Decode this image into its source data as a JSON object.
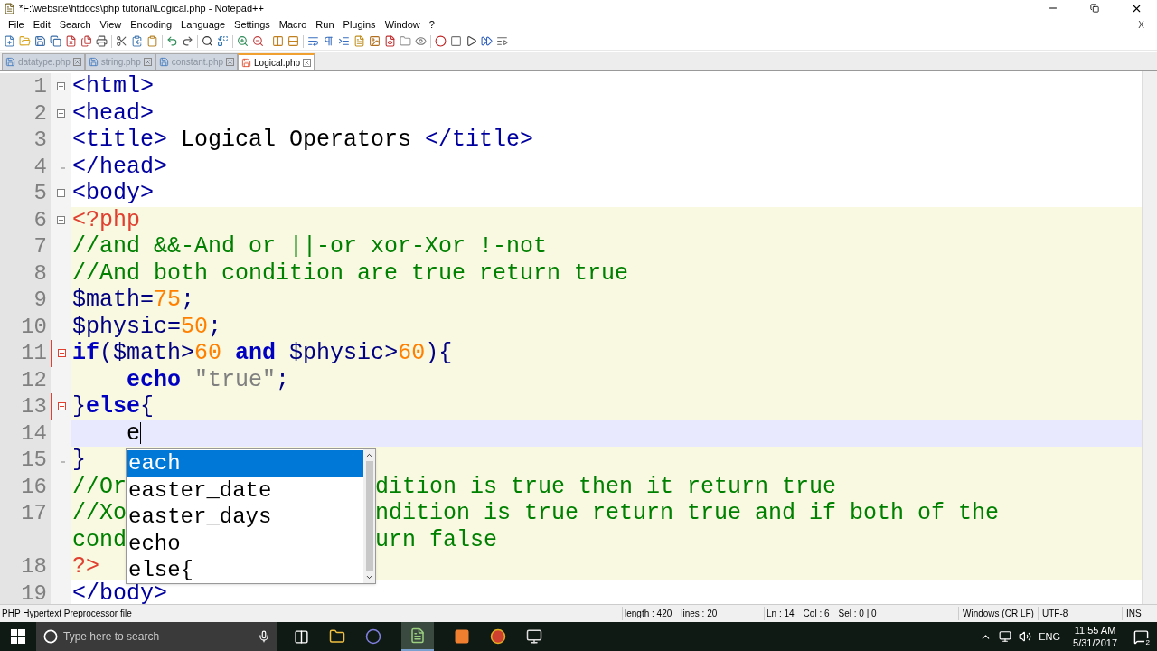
{
  "window": {
    "title": "*F:\\website\\htdocs\\php tutorial\\Logical.php - Notepad++"
  },
  "menu": [
    "File",
    "Edit",
    "Search",
    "View",
    "Encoding",
    "Language",
    "Settings",
    "Macro",
    "Run",
    "Plugins",
    "Window",
    "?"
  ],
  "menu_close": "X",
  "tabs": [
    {
      "label": "datatype.php",
      "selected": false,
      "modified": false
    },
    {
      "label": "string.php",
      "selected": false,
      "modified": false
    },
    {
      "label": "constant.php",
      "selected": false,
      "modified": false
    },
    {
      "label": "Logical.php",
      "selected": true,
      "modified": true
    }
  ],
  "editor": {
    "lines": [
      {
        "number": "1",
        "kind": "start",
        "php": false,
        "current": false,
        "rows": [
          [
            {
              "text": "<html>",
              "kind": "tag"
            }
          ]
        ]
      },
      {
        "number": "2",
        "kind": "start",
        "php": false,
        "current": false,
        "rows": [
          [
            {
              "text": "<head>",
              "kind": "tag"
            }
          ]
        ]
      },
      {
        "number": "3",
        "kind": "plain",
        "php": false,
        "current": false,
        "rows": [
          [
            {
              "text": "<title>",
              "kind": "tag"
            },
            {
              "text": " Logical Operators ",
              "kind": "text"
            },
            {
              "text": "</title>",
              "kind": "tag"
            }
          ]
        ]
      },
      {
        "number": "4",
        "kind": "end",
        "php": false,
        "current": false,
        "rows": [
          [
            {
              "text": "</head>",
              "kind": "tag"
            }
          ]
        ]
      },
      {
        "number": "5",
        "kind": "start",
        "php": false,
        "current": false,
        "rows": [
          [
            {
              "text": "<body>",
              "kind": "tag"
            }
          ]
        ]
      },
      {
        "number": "6",
        "kind": "start",
        "php": true,
        "current": false,
        "rows": [
          [
            {
              "text": "<?php",
              "kind": "php"
            }
          ]
        ]
      },
      {
        "number": "7",
        "kind": "plain",
        "php": true,
        "current": false,
        "rows": [
          [
            {
              "text": "//and &&-And or ||-or xor-Xor !-not",
              "kind": "comment"
            }
          ]
        ]
      },
      {
        "number": "8",
        "kind": "plain",
        "php": true,
        "current": false,
        "rows": [
          [
            {
              "text": "//And both condition are true return true",
              "kind": "comment"
            }
          ]
        ]
      },
      {
        "number": "9",
        "kind": "plain",
        "php": true,
        "current": false,
        "rows": [
          [
            {
              "text": "$math",
              "kind": "var"
            },
            {
              "text": "=",
              "kind": "op"
            },
            {
              "text": "75",
              "kind": "num"
            },
            {
              "text": ";",
              "kind": "op"
            }
          ]
        ]
      },
      {
        "number": "10",
        "kind": "plain",
        "php": true,
        "current": false,
        "rows": [
          [
            {
              "text": "$physic",
              "kind": "var"
            },
            {
              "text": "=",
              "kind": "op"
            },
            {
              "text": "50",
              "kind": "num"
            },
            {
              "text": ";",
              "kind": "op"
            }
          ]
        ]
      },
      {
        "number": "11",
        "kind": "block",
        "php": true,
        "current": false,
        "rows": [
          [
            {
              "text": "if",
              "kind": "keyword"
            },
            {
              "text": "(",
              "kind": "op"
            },
            {
              "text": "$math",
              "kind": "var"
            },
            {
              "text": ">",
              "kind": "op"
            },
            {
              "text": "60",
              "kind": "num"
            },
            {
              "text": " and ",
              "kind": "keyword"
            },
            {
              "text": "$physic",
              "kind": "var"
            },
            {
              "text": ">",
              "kind": "op"
            },
            {
              "text": "60",
              "kind": "num"
            },
            {
              "text": "){",
              "kind": "op"
            }
          ]
        ]
      },
      {
        "number": "12",
        "kind": "plain",
        "php": true,
        "current": false,
        "rows": [
          [
            {
              "text": "    echo",
              "kind": "keyword"
            },
            {
              "text": " \"true\"",
              "kind": "string"
            },
            {
              "text": ";",
              "kind": "op"
            }
          ]
        ]
      },
      {
        "number": "13",
        "kind": "block",
        "php": true,
        "current": false,
        "rows": [
          [
            {
              "text": "}",
              "kind": "op"
            },
            {
              "text": "else",
              "kind": "keyword"
            },
            {
              "text": "{",
              "kind": "op"
            }
          ]
        ]
      },
      {
        "number": "14",
        "kind": "plain",
        "php": true,
        "current": true,
        "rows": [
          [
            {
              "text": "    e",
              "kind": "text"
            }
          ]
        ]
      },
      {
        "number": "15",
        "kind": "end",
        "php": true,
        "current": false,
        "rows": [
          [
            {
              "text": "}",
              "kind": "op"
            }
          ]
        ]
      },
      {
        "number": "16",
        "kind": "plain",
        "php": true,
        "current": false,
        "rows": [
          [
            {
              "text": "//Or",
              "kind": "comment"
            },
            {
              "text": "dition is true then it return true",
              "kind": "comment",
              "after_popup": true
            }
          ]
        ]
      },
      {
        "number": "17",
        "kind": "plain",
        "php": true,
        "current": false,
        "rows": [
          [
            {
              "text": "//Xo",
              "kind": "comment"
            },
            {
              "text": "ndition is true return true and if both of the",
              "kind": "comment",
              "after_popup": true
            }
          ],
          [
            {
              "text": "cond",
              "kind": "comment"
            },
            {
              "text": "urn false",
              "kind": "comment",
              "after_popup": true
            }
          ]
        ]
      },
      {
        "number": "18",
        "kind": "plain",
        "php": true,
        "current": false,
        "rows": [
          [
            {
              "text": "?>",
              "kind": "php"
            }
          ]
        ]
      },
      {
        "number": "19",
        "kind": "plain",
        "php": false,
        "current": false,
        "rows": [
          [
            {
              "text": "</body>",
              "kind": "tag"
            }
          ]
        ]
      }
    ]
  },
  "autocomplete": [
    {
      "label": "each",
      "selected": true
    },
    {
      "label": "easter_date",
      "selected": false
    },
    {
      "label": "easter_days",
      "selected": false
    },
    {
      "label": "echo",
      "selected": false
    },
    {
      "label": "else{",
      "selected": false
    }
  ],
  "status_bar": {
    "file_type": "PHP Hypertext Preprocessor file",
    "length": "length : 420",
    "lines": "lines : 20",
    "ln": "Ln : 14",
    "col": "Col : 6",
    "sel": "Sel : 0 | 0",
    "eol": "Windows (CR LF)",
    "encoding": "UTF-8",
    "mode": "INS"
  },
  "taskbar": {
    "search_placeholder": "Type here to search",
    "language": "ENG",
    "time": "11:55 AM",
    "date": "5/31/2017",
    "notifications": "2"
  }
}
